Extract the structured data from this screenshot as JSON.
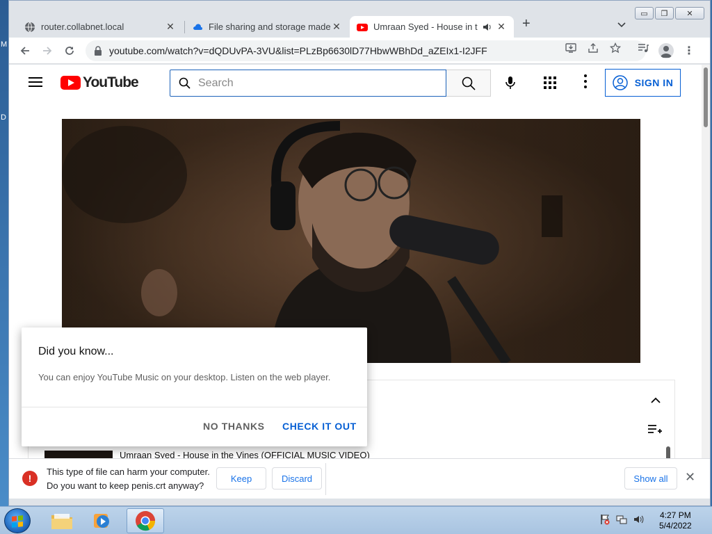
{
  "desktop": {
    "glyphs": [
      "M",
      "D"
    ]
  },
  "window": {
    "controls": {
      "minimize": "▭",
      "restore": "❐",
      "close": "✕"
    }
  },
  "tabs": [
    {
      "title": "router.collabnet.local",
      "favicon": "globe-icon",
      "active": false
    },
    {
      "title": "File sharing and storage made simple",
      "favicon": "cloud-icon",
      "active": false
    },
    {
      "title": "Umraan Syed - House in the",
      "favicon": "youtube-icon",
      "active": true,
      "audio": "speaker-icon"
    }
  ],
  "toolbar": {
    "url": "youtube.com/watch?v=dQDUvPA-3VU&list=PLzBp6630lD77HbwWBhDd_aZEIx1-I2JFF",
    "icons": [
      "back-icon",
      "forward-icon",
      "reload-icon",
      "lock-icon",
      "install-icon",
      "share-icon",
      "star-icon",
      "media-icon",
      "profile-icon",
      "menu-icon"
    ]
  },
  "youtube": {
    "logo_text": "YouTube",
    "search_placeholder": "Search",
    "sign_in_label": "SIGN IN",
    "playlist_item_title": "Umraan Syed - House in the Vines (OFFICIAL MUSIC VIDEO)"
  },
  "popup": {
    "title": "Did you know...",
    "text": "You can enjoy YouTube Music on your desktop. Listen on the web player.",
    "no_label": "NO THANKS",
    "yes_label": "CHECK IT OUT"
  },
  "download_bar": {
    "line1": "This type of file can harm your computer.",
    "line2": "Do you want to keep penis.crt anyway?",
    "keep_label": "Keep",
    "discard_label": "Discard",
    "show_all_label": "Show all",
    "close_glyph": "✕"
  },
  "taskbar": {
    "time": "4:27 PM",
    "date": "5/4/2022"
  },
  "colors": {
    "youtube_red": "#ff0000",
    "link_blue": "#065fd4",
    "chrome_blue": "#1a73e8",
    "warning_red": "#d93025"
  }
}
